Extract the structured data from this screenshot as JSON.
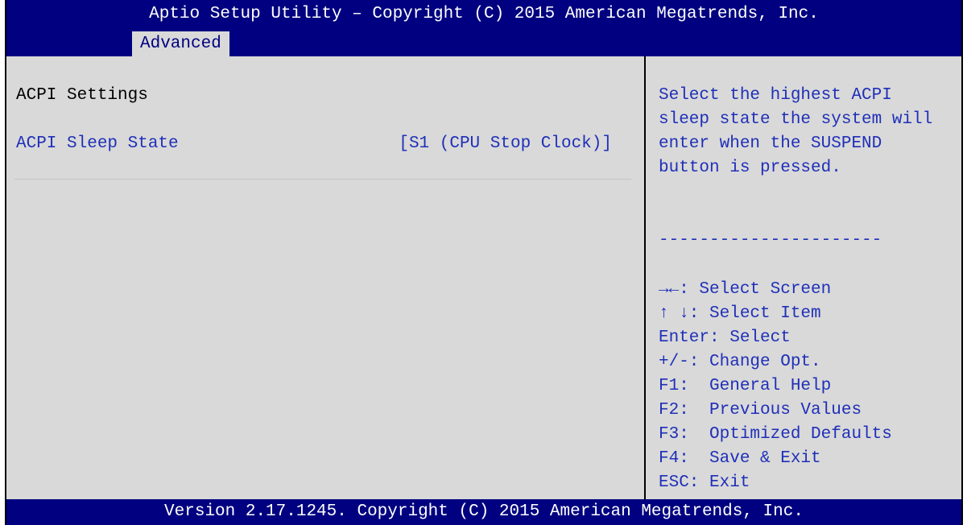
{
  "title": "Aptio Setup Utility – Copyright (C) 2015 American Megatrends, Inc.",
  "tabs": [
    {
      "label": "Advanced",
      "selected": true
    }
  ],
  "main": {
    "section_title": "ACPI Settings",
    "setting": {
      "label": "ACPI Sleep State",
      "value": "[S1 (CPU Stop Clock)]"
    }
  },
  "help": {
    "description": [
      "Select the highest ACPI",
      "sleep state the system will",
      "enter when the SUSPEND",
      "button is pressed."
    ],
    "separator": "----------------------",
    "keys": [
      "→←: Select Screen",
      "↑ ↓: Select Item",
      "Enter: Select",
      "+/-: Change Opt.",
      "F1:  General Help",
      "F2:  Previous Values",
      "F3:  Optimized Defaults",
      "F4:  Save & Exit",
      "ESC: Exit"
    ]
  },
  "footer": "Version 2.17.1245. Copyright (C) 2015 American Megatrends, Inc.",
  "colors": {
    "bar_background": "#000080",
    "panel_background": "#d9d9d9",
    "highlight_text": "#1f2fb8"
  }
}
